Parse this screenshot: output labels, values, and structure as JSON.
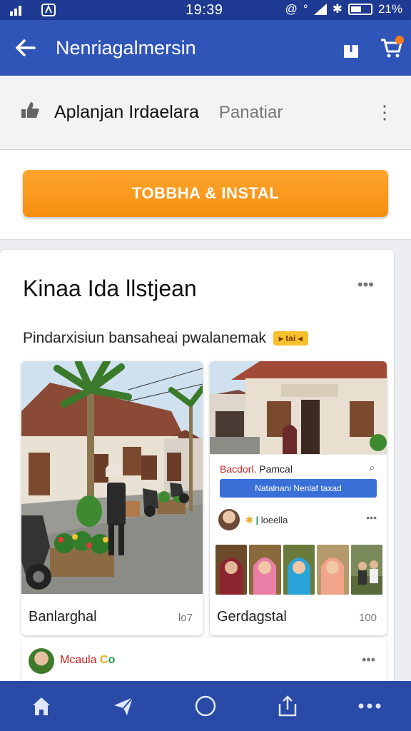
{
  "status_bar": {
    "time": "19:39",
    "battery_text": "21%"
  },
  "app_bar": {
    "title": "Nenriagalmersin",
    "icons": [
      "back-arrow-icon",
      "share-icon",
      "cart-icon"
    ],
    "accent_color": "#2f55b8"
  },
  "subheader": {
    "title": "Aplanjan Irdaelara",
    "tag": "Panatiar"
  },
  "install_button": {
    "label": "TOBBHA & INSTAL",
    "color": "#f7941d"
  },
  "post": {
    "title": "Kinaa Ida llstjean",
    "subtitle": "Pindarxisiun bansaheai pwalanemak",
    "badge": "tai",
    "left_photo": {
      "caption": "Banlarghal",
      "count": "lo7"
    },
    "right_photo": {
      "caption": "Gerdagstal",
      "count": "100",
      "inner_name_red": "Bacdorl",
      "inner_name_dark": ". Pamcal",
      "inner_button": "Natalnani Nenlaf taxad",
      "inner_user": "loeella"
    }
  },
  "second_post": {
    "name": "Mcaula",
    "name_suffix_yellow": "C",
    "name_suffix_green": "o"
  },
  "bottom_nav": {
    "items": [
      "home-icon",
      "send-icon",
      "circle-icon",
      "share-icon",
      "more-icon"
    ]
  }
}
